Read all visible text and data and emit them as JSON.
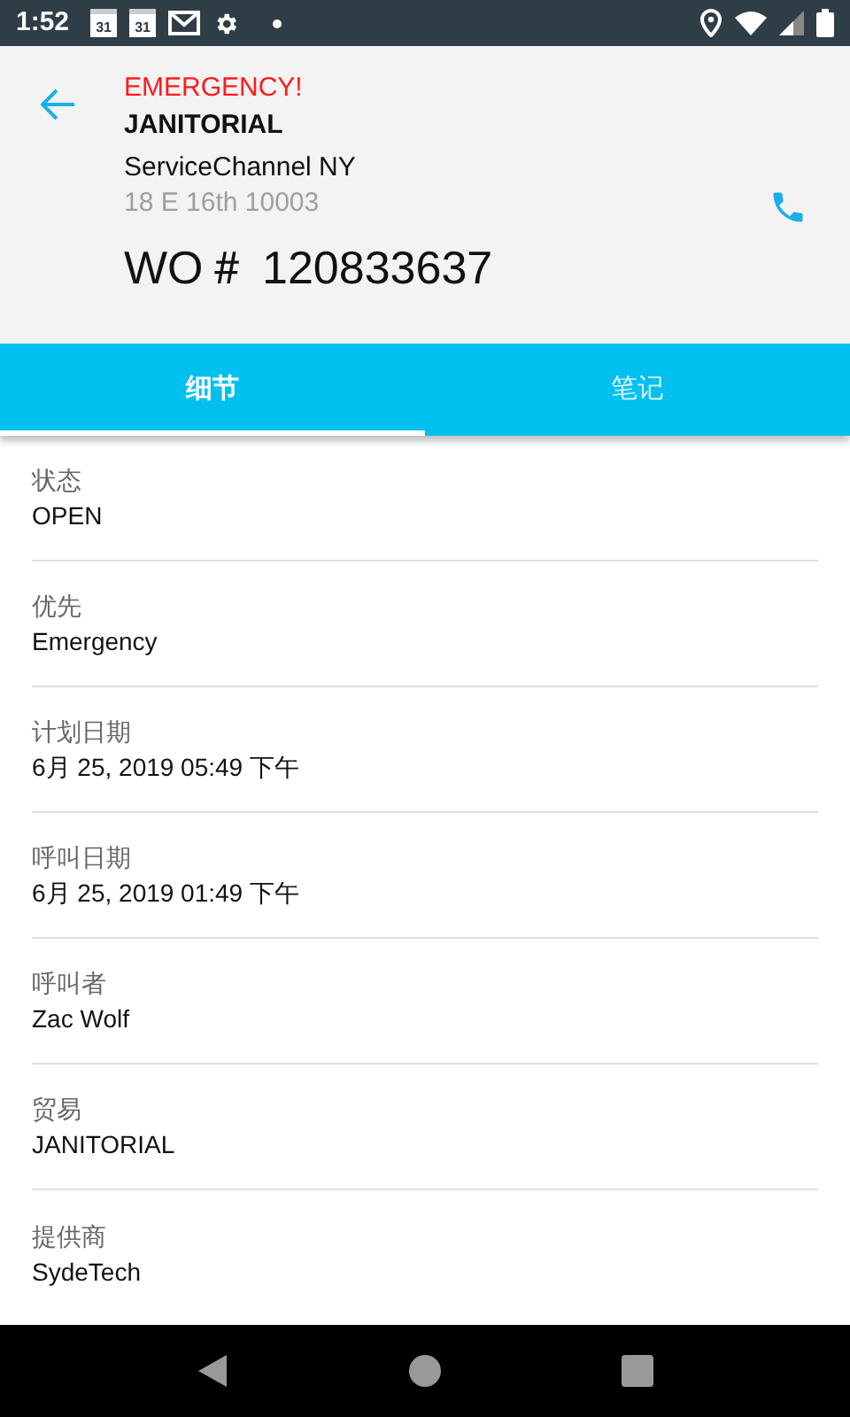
{
  "status_bar": {
    "time": "1:52",
    "calendar_icons": [
      "31",
      "31"
    ]
  },
  "header": {
    "alert": "EMERGENCY!",
    "trade": "JANITORIAL",
    "location": "ServiceChannel NY",
    "address": "18 E 16th 10003",
    "work_order": "WO＃ 120833637"
  },
  "tabs": [
    {
      "label": "细节",
      "selected": true
    },
    {
      "label": "笔记",
      "selected": false
    }
  ],
  "details": [
    {
      "label": "状态",
      "value": "OPEN"
    },
    {
      "label": "优先",
      "value": "Emergency"
    },
    {
      "label": "计划日期",
      "value": "6月 25, 2019 05:49 下午"
    },
    {
      "label": "呼叫日期",
      "value": "6月 25, 2019 01:49 下午"
    },
    {
      "label": "呼叫者",
      "value": "Zac Wolf"
    },
    {
      "label": "贸易",
      "value": "JANITORIAL"
    },
    {
      "label": "提供商",
      "value": "SydeTech"
    }
  ]
}
